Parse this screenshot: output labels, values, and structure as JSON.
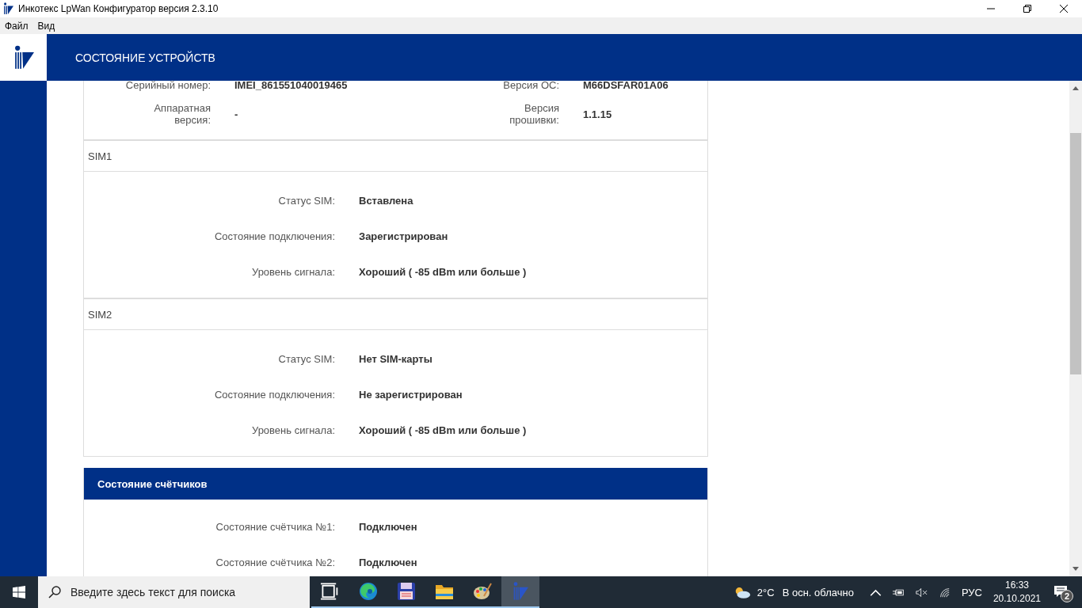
{
  "window": {
    "title": "Инкотекс LpWan Конфигуратор версия 2.3.10"
  },
  "menu": [
    "Файл",
    "Вид"
  ],
  "header": {
    "title": "СОСТОЯНИЕ УСТРОЙСТВ"
  },
  "device_info": [
    {
      "label": "Серийный номер:",
      "value": "IMEI_861551040019465"
    },
    {
      "label": "Версия ОС:",
      "value": "M66DSFAR01A06"
    },
    {
      "label": "Аппаратная версия:",
      "value": "-"
    },
    {
      "label": "Версия прошивки:",
      "value": "1.1.15"
    }
  ],
  "sim_sections": [
    {
      "title": "SIM1",
      "rows": [
        {
          "label": "Статус SIM:",
          "value": "Вставлена"
        },
        {
          "label": "Состояние подключения:",
          "value": "Зарегистрирован"
        },
        {
          "label": "Уровень сигнала:",
          "value": "Хороший ( -85 dBm или больше )"
        }
      ]
    },
    {
      "title": "SIM2",
      "rows": [
        {
          "label": "Статус SIM:",
          "value": "Нет SIM-карты"
        },
        {
          "label": "Состояние подключения:",
          "value": "Не зарегистрирован"
        },
        {
          "label": "Уровень сигнала:",
          "value": "Хороший ( -85 dBm или больше )"
        }
      ]
    }
  ],
  "meters": {
    "title": "Состояние счётчиков",
    "rows": [
      {
        "label": "Состояние счётчика №1:",
        "value": "Подключен"
      },
      {
        "label": "Состояние счётчика №2:",
        "value": "Подключен"
      }
    ]
  },
  "taskbar": {
    "search": {
      "placeholder": "Введите здесь текст для поиска"
    },
    "apps": [
      {
        "kind": "taskview",
        "selected": false
      },
      {
        "kind": "browser",
        "selected": false
      },
      {
        "kind": "floppy",
        "selected": false
      },
      {
        "kind": "folder",
        "selected": false
      },
      {
        "kind": "paint",
        "selected": false
      },
      {
        "kind": "logo",
        "selected": true
      }
    ],
    "weather": {
      "temperature": "2°C",
      "condition": "В осн. облачно"
    },
    "language": "РУС",
    "time": "16:33",
    "date": "20.10.2021",
    "notifications": "2"
  }
}
